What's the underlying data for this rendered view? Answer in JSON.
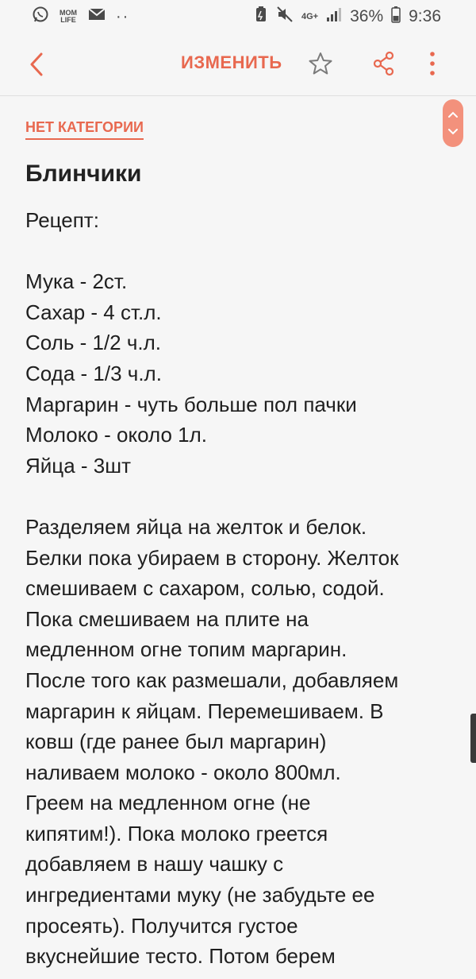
{
  "status_bar": {
    "mom_life": "MOM LIFE",
    "dots": "··",
    "network": "4G+",
    "battery": "36%",
    "time": "9:36",
    "icons": [
      "whatsapp-icon",
      "mom-life-icon",
      "mail-icon",
      "battery-saver-icon",
      "mute-icon",
      "signal-icon",
      "battery-icon"
    ]
  },
  "toolbar": {
    "edit_label": "ИЗМЕНИТЬ",
    "accent_color": "#e8684f"
  },
  "note": {
    "category": "НЕТ КАТЕГОРИИ",
    "title": "Блинчики",
    "heading": "Рецепт:",
    "ingredients": [
      "Мука - 2ст.",
      "Сахар - 4 ст.л.",
      "Соль - 1/2 ч.л.",
      "Сода - 1/3 ч.л.",
      "Маргарин - чуть больше пол пачки",
      "Молоко - около 1л.",
      "Яйца - 3шт"
    ],
    "instructions": [
      "Разделяем яйца на желток и белок.",
      "Белки пока убираем в сторону. Желток",
      "смешиваем с сахаром, солью, содой.",
      "Пока смешиваем на плите на",
      "медленном огне топим маргарин.",
      "После того как размешали, добавляем",
      "маргарин к яйцам.  Перемешиваем. В",
      "ковш (где ранее был маргарин)",
      "наливаем молоко - около 800мл.",
      "Греем на медленном огне (не",
      "кипятим!). Пока молоко греется",
      "добавляем в нашу чашку с",
      "ингредиентами муку (не забудьте ее",
      "просеять). Получится густое",
      "вкуснейшие тесто. Потом берем"
    ]
  }
}
